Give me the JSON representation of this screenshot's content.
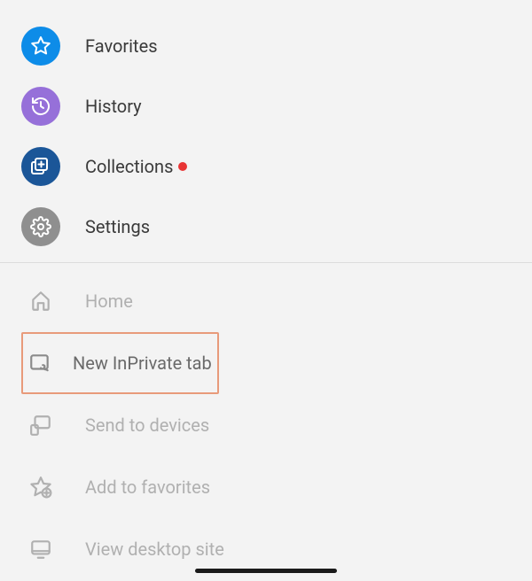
{
  "primary_menu": {
    "favorites": {
      "label": "Favorites"
    },
    "history": {
      "label": "History"
    },
    "collections": {
      "label": "Collections",
      "has_notification": true
    },
    "settings": {
      "label": "Settings"
    }
  },
  "secondary_menu": {
    "home": {
      "label": "Home"
    },
    "new_inprivate": {
      "label": "New InPrivate tab"
    },
    "send_to_devices": {
      "label": "Send to devices"
    },
    "add_to_favorites": {
      "label": "Add to favorites"
    },
    "view_desktop_site": {
      "label": "View desktop site"
    }
  },
  "colors": {
    "favorites_bg": "#0d8ce8",
    "history_bg": "#9670d9",
    "collections_bg": "#1b5698",
    "settings_bg": "#8f8f8f",
    "secondary_icon": "#b0b0b0",
    "highlight_border": "#e89a7a",
    "notification_dot": "#e83434"
  }
}
